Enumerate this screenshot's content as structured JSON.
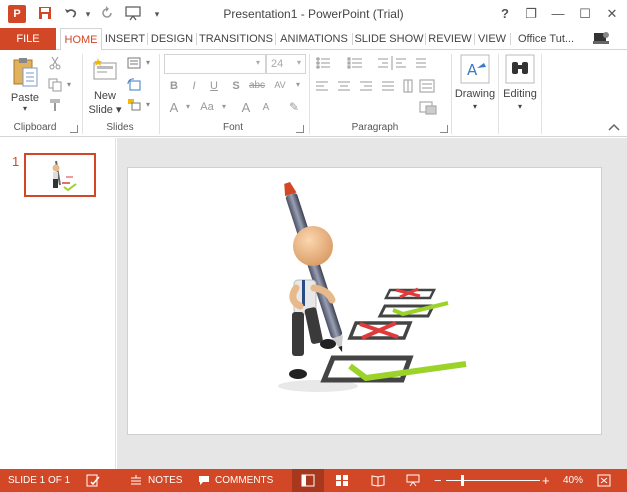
{
  "window": {
    "title": "Presentation1 - PowerPoint (Trial)",
    "app_logo": "P",
    "help": "?",
    "restore": "❐",
    "minimize": "—",
    "maximize": "☐",
    "close": "✕"
  },
  "qat": {
    "save_icon": "💾",
    "undo_icon": "↶",
    "redo_icon": "↻",
    "customize": "▾"
  },
  "tabs": {
    "file": "FILE",
    "items": [
      "HOME",
      "INSERT",
      "DESIGN",
      "TRANSITIONS",
      "ANIMATIONS",
      "SLIDE SHOW",
      "REVIEW",
      "VIEW"
    ],
    "active": "HOME",
    "account": "Office Tut..."
  },
  "ribbon": {
    "clipboard": {
      "label": "Clipboard",
      "paste": "Paste"
    },
    "slides": {
      "label": "Slides",
      "new_slide_line1": "New",
      "new_slide_line2": "Slide ▾"
    },
    "font": {
      "label": "Font",
      "font_name": "",
      "font_size": "24",
      "bold": "B",
      "italic": "I",
      "underline": "U",
      "shadow": "S",
      "strike": "abc",
      "spacing": "AV",
      "case": "Aa",
      "grow": "A",
      "shrink": "A",
      "font_color": "A",
      "clear": "✎"
    },
    "paragraph": {
      "label": "Paragraph"
    },
    "drawing": {
      "label": "Drawing"
    },
    "editing": {
      "label": "Editing"
    }
  },
  "thumbnails": [
    {
      "number": "1"
    }
  ],
  "statusbar": {
    "slide_info": "SLIDE 1 OF 1",
    "notes": "NOTES",
    "comments": "COMMENTS",
    "zoom_minus": "−",
    "zoom_plus": "+",
    "zoom": "40%",
    "zoom_level_percent": 40
  },
  "colors": {
    "accent": "#D24726",
    "status_active": "#A8381D",
    "check_green": "#9BD329",
    "cross_red": "#E03A3A"
  }
}
